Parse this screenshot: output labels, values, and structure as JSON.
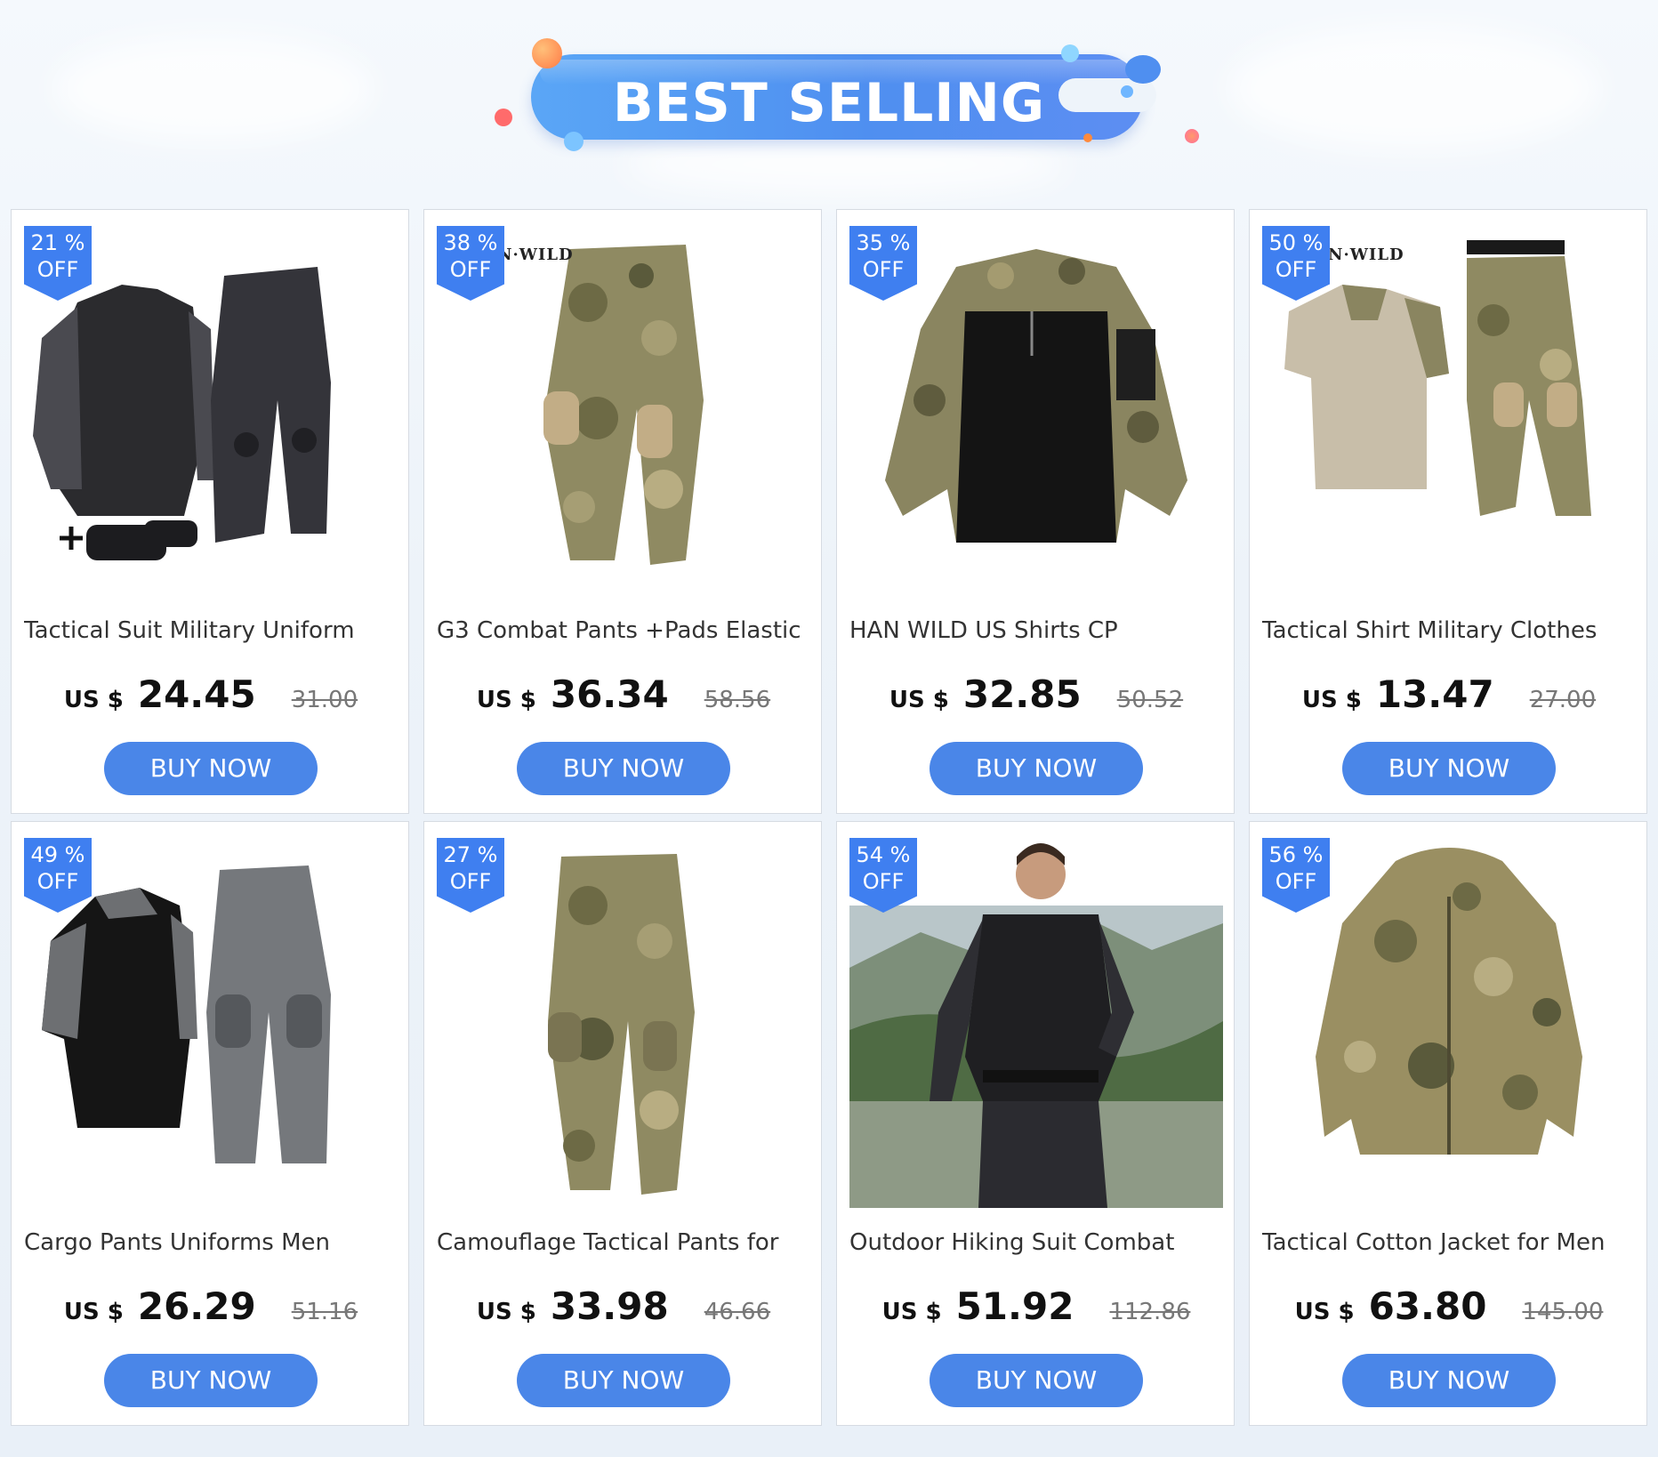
{
  "banner": {
    "title": "BEST SELLING",
    "colors": {
      "pill": "#4f8ff0",
      "text": "#ffffff"
    }
  },
  "colors": {
    "badge": "#3f7ff0",
    "button": "#4a86e8",
    "card_border": "#d6dbe2"
  },
  "products": [
    {
      "badge_percent": "21 %",
      "badge_off": "OFF",
      "title": "Tactical Suit Military Uniform",
      "currency": "US $",
      "price": "24.45",
      "old_price": "31.00",
      "button_label": "BUY NOW",
      "image": "black-tactical-suit-with-knee-pads"
    },
    {
      "badge_percent": "38 %",
      "badge_off": "OFF",
      "brand": "N·WILD",
      "title": "G3 Combat Pants +Pads Elastic",
      "currency": "US $",
      "price": "36.34",
      "old_price": "58.56",
      "button_label": "BUY NOW",
      "image": "multicam-combat-pants"
    },
    {
      "badge_percent": "35 %",
      "badge_off": "OFF",
      "title": "HAN WILD US Shirts CP",
      "currency": "US $",
      "price": "32.85",
      "old_price": "50.52",
      "button_label": "BUY NOW",
      "image": "camo-hooded-shirt"
    },
    {
      "badge_percent": "50 %",
      "badge_off": "OFF",
      "brand": "N·WILD",
      "title": "Tactical Shirt Military Clothes",
      "currency": "US $",
      "price": "13.47",
      "old_price": "27.00",
      "button_label": "BUY NOW",
      "image": "short-sleeve-shirt-and-camo-pants"
    },
    {
      "badge_percent": "49 %",
      "badge_off": "OFF",
      "title": "Cargo Pants Uniforms Men",
      "currency": "US $",
      "price": "26.29",
      "old_price": "51.16",
      "button_label": "BUY NOW",
      "image": "grey-hoodie-and-cargo-pants"
    },
    {
      "badge_percent": "27 %",
      "badge_off": "OFF",
      "title": "Camouflage Tactical Pants for",
      "currency": "US $",
      "price": "33.98",
      "old_price": "46.66",
      "button_label": "BUY NOW",
      "image": "camouflage-tactical-pants"
    },
    {
      "badge_percent": "54 %",
      "badge_off": "OFF",
      "title": "Outdoor Hiking Suit Combat",
      "currency": "US $",
      "price": "51.92",
      "old_price": "112.86",
      "button_label": "BUY NOW",
      "image": "man-in-black-camo-suit-outdoors"
    },
    {
      "badge_percent": "56 %",
      "badge_off": "OFF",
      "title": "Tactical Cotton Jacket for Men",
      "currency": "US $",
      "price": "63.80",
      "old_price": "145.00",
      "button_label": "BUY NOW",
      "image": "multicam-padded-jacket"
    }
  ]
}
